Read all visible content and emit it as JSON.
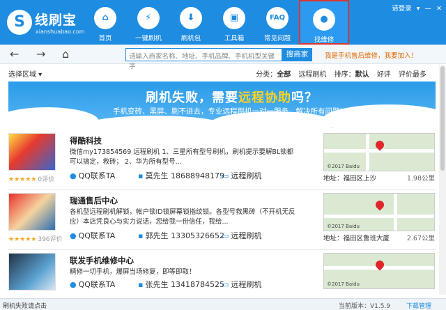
{
  "header": {
    "logo_glyph": "S",
    "brand": "线刷宝",
    "brand_sub": "xianshuabao.com",
    "nav": [
      {
        "label": "首页",
        "glyph": "⌂"
      },
      {
        "label": "一键刷机",
        "glyph": "⚡"
      },
      {
        "label": "刷机包",
        "glyph": "⬇"
      },
      {
        "label": "工具箱",
        "glyph": "▣"
      },
      {
        "label": "常见问题",
        "glyph": "FAQ"
      },
      {
        "label": "找维修",
        "glyph": "●"
      }
    ],
    "login": "请登录",
    "window_controls": [
      "▾",
      "—",
      "✕"
    ]
  },
  "toolbar": {
    "back": "←",
    "forward": "→",
    "home": "⌂",
    "search_placeholder": "请输入商家名称、地址、手机品牌、手机机型关键字",
    "search_button": "搜商家",
    "promo": "我是手机售后维修，我要加入！"
  },
  "filter": {
    "region": "选择区域 ▾",
    "category_label": "分类：",
    "categories": [
      "全部",
      "远程刷机"
    ],
    "sort_label": "排序：",
    "sorts": [
      "默认",
      "好评",
      "评价最多"
    ]
  },
  "banner": {
    "title_a": "刷机失败，需要",
    "title_b": "远程协助",
    "title_c": "吗？",
    "subtitle": "手机变砖、黑屏、刷不进去，专业远程刷机一对一服务，解决所有问题！",
    "tag": "广告"
  },
  "shops": [
    {
      "name": "得酷科技",
      "desc": "微信my173854569 远程刷机 1、三星所有型号刷机，刷机提示要解BL锁都可以搞定，救砖； 2、华为所有型号...",
      "stars": "★★★★★",
      "reviews": "0评价",
      "qq": "QQ联系TA",
      "contact": "莫先生 18688948179",
      "service": "远程刷机",
      "address": "地址：福田区上沙",
      "distance": "1.98公里",
      "map_tag": "©2017 Baidu"
    },
    {
      "name": "瑞通售后中心",
      "desc": "各机型远程刷机解锁，帐户锁ID锁屏幕锁指纹锁。各型号救黑砖（不开机无反应）本店凭良心与实力说话，您给我一份信任，我给...",
      "stars": "★★★★★",
      "reviews": "396评价",
      "qq": "QQ联系TA",
      "contact": "郭先生 13305326652",
      "service": "远程刷机",
      "address": "地址：福田区鲁班大厦",
      "distance": "2.67公里",
      "map_tag": "©2017 Baidu"
    },
    {
      "name": "联发手机维修中心",
      "desc": "精修一切手机，爆屏当场修复，即等即取！",
      "stars": "",
      "reviews": "",
      "qq": "QQ联系TA",
      "contact": "张先生 13418784525",
      "service": "远程刷机",
      "address": "",
      "distance": "",
      "map_tag": "©2017 Baidu"
    }
  ],
  "status": {
    "left": "刷机失败请点击",
    "version": "当前版本：V1.5.9",
    "download": "下载管理"
  }
}
